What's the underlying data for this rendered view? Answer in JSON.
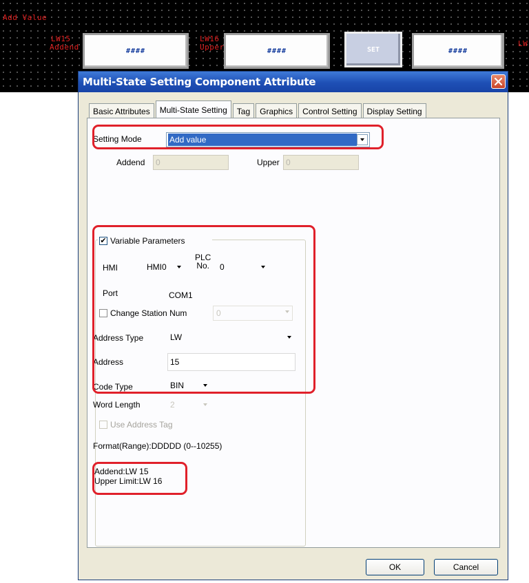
{
  "background": {
    "title": "Add Value",
    "left_label_line1": "LW15",
    "left_label_line2": "Addend",
    "mid_label_line1": "LW16",
    "mid_label_line2": "Upper",
    "right_label": "LW",
    "display1": "####",
    "display2": "####",
    "set_button": "SET",
    "display3": "####"
  },
  "dialog": {
    "title": "Multi-State Setting Component Attribute",
    "tabs": [
      {
        "label": "Basic Attributes",
        "active": false
      },
      {
        "label": "Multi-State Setting",
        "active": true
      },
      {
        "label": "Tag",
        "active": false
      },
      {
        "label": "Graphics",
        "active": false
      },
      {
        "label": "Control Setting",
        "active": false
      },
      {
        "label": "Display Setting",
        "active": false
      }
    ],
    "setting_mode": {
      "label": "Setting Mode",
      "value": "Add value"
    },
    "addend": {
      "label": "Addend",
      "value": "0"
    },
    "upper": {
      "label": "Upper",
      "value": "0"
    },
    "variable_parameters": {
      "label": "Variable Parameters",
      "checked": true
    },
    "hmi": {
      "label": "HMI",
      "value": "HMI0"
    },
    "plc_no": {
      "label_line1": "PLC",
      "label_line2": "No.",
      "value": "0"
    },
    "port": {
      "label": "Port",
      "value": "COM1"
    },
    "change_station": {
      "label": "Change Station Num",
      "checked": false,
      "value": "0"
    },
    "address_type": {
      "label": "Address Type",
      "value": "LW"
    },
    "address": {
      "label": "Address",
      "value": "15"
    },
    "code_type": {
      "label": "Code Type",
      "value": "BIN"
    },
    "word_length": {
      "label": "Word Length",
      "value": "2"
    },
    "use_address_tag": {
      "label": "Use Address Tag",
      "checked": false
    },
    "format": "Format(Range):DDDDD (0--10255)",
    "summary_line1": "Addend:LW 15",
    "summary_line2": "Upper Limit:LW 16",
    "ok_label": "OK",
    "cancel_label": "Cancel"
  },
  "colors": {
    "highlight": "#e0202a",
    "title_bar": "#1e4fb5",
    "selection": "#316ac5",
    "hmi_text": "#e02020"
  }
}
